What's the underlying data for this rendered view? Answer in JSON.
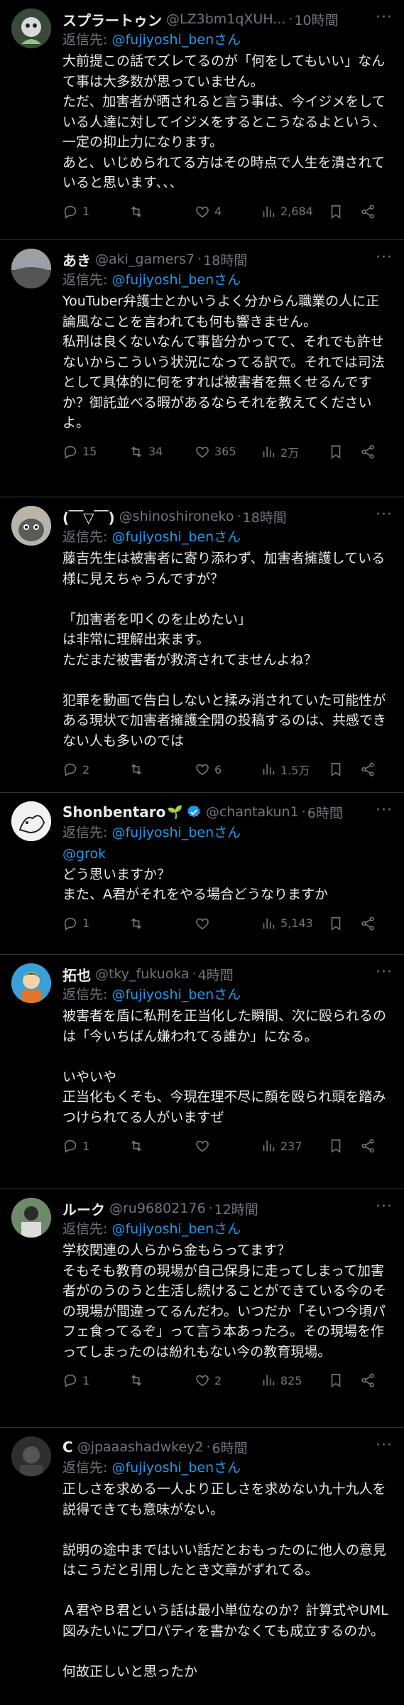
{
  "reply_prefix": "返信先: ",
  "reply_suffix": "さん",
  "tweets": [
    {
      "name": "スプラートゥン",
      "handle": "@LZ3bm1qXUH...",
      "time": "10時間",
      "reply_to": "@fujiyoshi_ben",
      "text": "大前提この話でズレてるのが「何をしてもいい」なんて事は大多数が思っていません。\nただ、加害者が晒されると言う事は、今イジメをしている人達に対してイジメをするとこうなるよという、一定の抑止力になります。\nあと、いじめられてる方はその時点で人生を潰されていると思います、、、",
      "replies": "1",
      "retweets": "",
      "likes": "4",
      "views": "2,684",
      "avatar_bg": "#3a4a3a"
    },
    {
      "name": "あき",
      "handle": "@aki_gamers7",
      "time": "18時間",
      "reply_to": "@fujiyoshi_ben",
      "text": "YouTuber弁護士とかいうよく分からん職業の人に正論風なことを言われても何も響きません。\n私刑は良くないなんて事皆分かってて、それでも許せないからこういう状況になってる訳で。それでは司法として具体的に何をすれば被害者を無くせるんですか？御託並べる暇があるならそれを教えてくださいよ。",
      "replies": "15",
      "retweets": "34",
      "likes": "365",
      "views": "2万",
      "avatar_bg": "#6b6b6b"
    },
    {
      "name": "(￣▽￣)",
      "handle": "@shinoshironeko",
      "time": "18時間",
      "reply_to": "@fujiyoshi_ben",
      "text": "藤吉先生は被害者に寄り添わず、加害者擁護している様に見えちゃうんですが？\n\n「加害者を叩くのを止めたい」\nは非常に理解出来ます。\nただまだ被害者が救済されてませんよね？\n\n犯罪を動画で告白しないと揉み消されていた可能性がある現状で加害者擁護全開の投稿するのは、共感できない人も多いのでは",
      "replies": "2",
      "retweets": "",
      "likes": "6",
      "views": "1.5万",
      "avatar_bg": "#8a8a8a"
    },
    {
      "name": "Shonbentaro",
      "handle": "@chantakun1",
      "time": "6時間",
      "reply_to": "@fujiyoshi_ben",
      "mention_line": "@grok",
      "text": "どう思いますか？\nまた、A君がそれをやる場合どうなりますか",
      "replies": "1",
      "retweets": "",
      "likes": "",
      "views": "5,143",
      "avatar_bg": "#f2f2f2"
    },
    {
      "name": "拓也",
      "handle": "@tky_fukuoka",
      "time": "4時間",
      "reply_to": "@fujiyoshi_ben",
      "text": "被害者を盾に私刑を正当化した瞬間、次に殴られるのは「今いちばん嫌われてる誰か」になる。\n\nいやいや\n正当化もくそも、今現在理不尽に顔を殴られ頭を踏みつけられてる人がいますぜ",
      "replies": "1",
      "retweets": "",
      "likes": "",
      "views": "237",
      "avatar_bg": "#2f7fc1"
    },
    {
      "name": "ルーク",
      "handle": "@ru96802176",
      "time": "12時間",
      "reply_to": "@fujiyoshi_ben",
      "text": "学校関連の人らから金もらってます？\nそもそも教育の現場が自己保身に走ってしまって加害者がのうのうと生活し続けることができている今のその現場が間違ってるんだわ。いつだか「そいつ今頃パフェ食ってるぞ」って言う本あったろ。その現場を作ってしまったのは紛れもない今の教育現場。",
      "replies": "1",
      "retweets": "",
      "likes": "2",
      "views": "825",
      "avatar_bg": "#4a5a4a"
    },
    {
      "name": "C",
      "handle": "@jpaaashadwkey2",
      "time": "6時間",
      "reply_to": "@fujiyoshi_ben",
      "text": "正しさを求める一人より正しさを求めない九十九人を説得できても意味がない。\n\n説明の途中まではいい話だとおもったのに他人の意見はこうだと引用したとき文章がずれてる。\n\nＡ君やＢ君という話は最小単位なのか？計算式やUML図みたいにプロパティを書かなくても成立するのか。\n\n何故正しいと思ったか",
      "replies": "",
      "retweets": "",
      "likes": "",
      "views": "",
      "avatar_bg": "#3a3a3a"
    }
  ]
}
